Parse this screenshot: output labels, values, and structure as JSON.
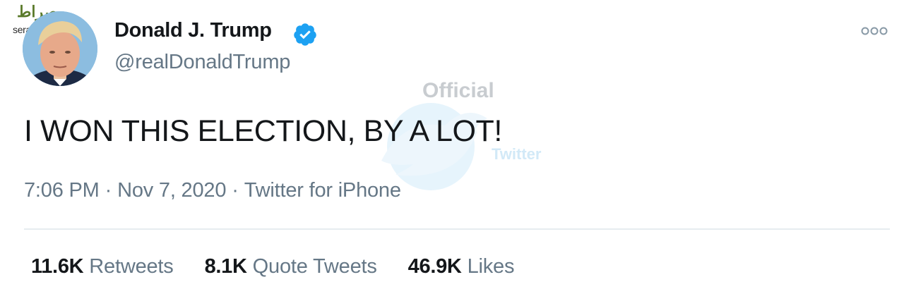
{
  "source": {
    "logo_text": "صراط",
    "url": "seratnews.ir"
  },
  "user": {
    "name": "Donald J. Trump",
    "handle": "@realDonaldTrump",
    "verified": true
  },
  "tweet": {
    "text": "I WON THIS ELECTION, BY A LOT!",
    "time": "7:06 PM",
    "date": "Nov 7, 2020",
    "client": "Twitter for iPhone",
    "separator": "·"
  },
  "stats": {
    "retweets": {
      "count": "11.6K",
      "label": "Retweets"
    },
    "quote_tweets": {
      "count": "8.1K",
      "label": "Quote Tweets"
    },
    "likes": {
      "count": "46.9K",
      "label": "Likes"
    }
  },
  "watermark": {
    "line1": "Official",
    "line2": "Twitter"
  },
  "colors": {
    "verified_blue": "#1da1f2",
    "secondary_text": "#657786",
    "primary_text": "#14171a"
  },
  "icons": {
    "verified": "verified-badge-icon",
    "more": "more-options-icon"
  }
}
